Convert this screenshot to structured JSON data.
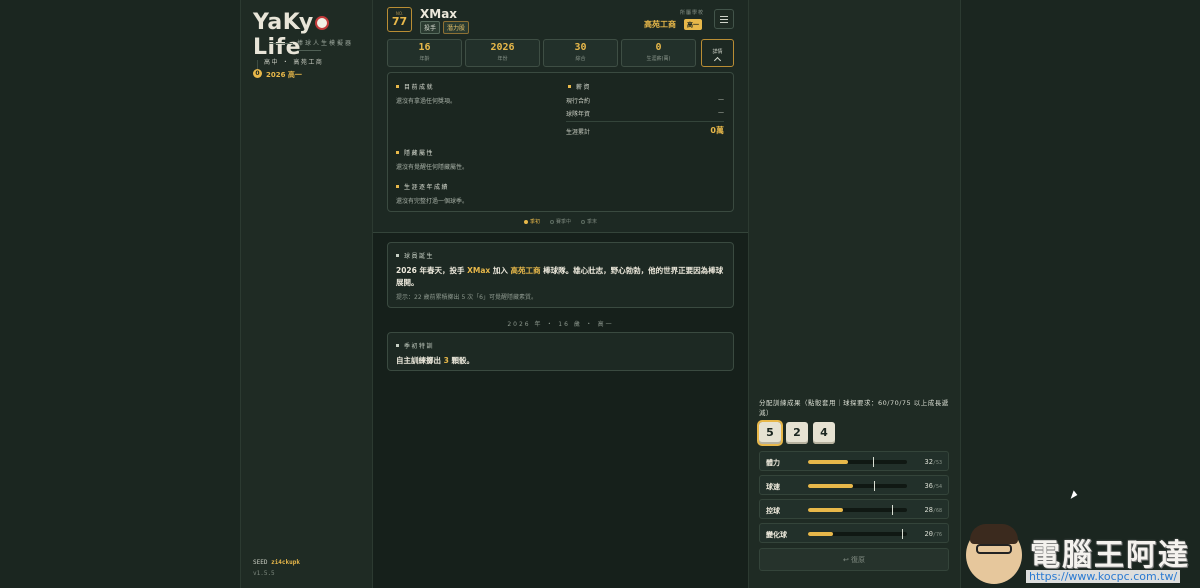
{
  "sidebar": {
    "logo_pre": "YaKy",
    "logo_post": "Life",
    "logo_sub": "棒球人生模擬器",
    "school_line": "高中 ・ 高苑工商",
    "timeline_index": "0",
    "timeline_current": "2026 高一",
    "seed_label": "SEED",
    "seed_value": "zi4ckupk",
    "version": "v1.5.5"
  },
  "header": {
    "no_label": "NO.",
    "number": "77",
    "player_name": "XMax",
    "tags": [
      "投手",
      "潛力股"
    ],
    "team_label": "所屬學校",
    "team_name": "高苑工商",
    "team_year": "高一"
  },
  "stats": [
    {
      "value": "16",
      "label": "年齡"
    },
    {
      "value": "2026",
      "label": "年份"
    },
    {
      "value": "30",
      "label": "綜合"
    },
    {
      "value": "0",
      "label": "生涯薪(萬)"
    }
  ],
  "detail_button": "詳情",
  "details": {
    "achievements_title": "目前成就",
    "achievements_text": "還沒有拿過任何獎項。",
    "salary_title": "薪資",
    "salary_rows": [
      {
        "label": "現行合約",
        "value": "—"
      },
      {
        "label": "球隊年資",
        "value": "—"
      }
    ],
    "career_total_label": "生涯累計",
    "career_total_value": "0萬",
    "hidden_title": "隱藏屬性",
    "hidden_text": "還沒有覺醒任何隱藏屬性。",
    "yearly_title": "生涯逐年成績",
    "yearly_text": "還沒有完整打過一個球季。"
  },
  "phases": [
    "季初",
    "賽季中",
    "季末"
  ],
  "story": {
    "title": "球員誕生",
    "text_parts": [
      "2026 年春天，投手 ",
      "XMax",
      " 加入 ",
      "高苑工商",
      " 棒球隊。雄心壯志，野心勃勃，他的世界正要因為棒球展開。"
    ],
    "hint": "提示：22 歲前累積擲出 5 次「6」可覺醒隱藏素質。"
  },
  "date_separator": "2026 年 ・ 16 歲 ・ 高一",
  "training": {
    "title": "季初特訓",
    "text_pre": "自主訓練擲出 ",
    "text_num": "3",
    "text_post": " 顆骰。"
  },
  "allocation": {
    "title": "分配訓練成果（點骰套用｜球探要求：60/70/75 以上成長遞減）",
    "dice": [
      "5",
      "2",
      "4"
    ],
    "attributes": [
      {
        "name": "體力",
        "value": "32",
        "max": "/53",
        "pct": 0.4,
        "cap_pct": 0.66
      },
      {
        "name": "球速",
        "value": "36",
        "max": "/54",
        "pct": 0.45,
        "cap_pct": 0.67
      },
      {
        "name": "控球",
        "value": "28",
        "max": "/68",
        "pct": 0.35,
        "cap_pct": 0.85
      },
      {
        "name": "變化球",
        "value": "20",
        "max": "/76",
        "pct": 0.25,
        "cap_pct": 0.95
      }
    ],
    "reset_label": "↩ 復原"
  },
  "watermark": {
    "title": "電腦王阿達",
    "url": "https://www.kocpc.com.tw/"
  },
  "colors": {
    "accent": "#e8b84a",
    "background": "#1b2620"
  }
}
